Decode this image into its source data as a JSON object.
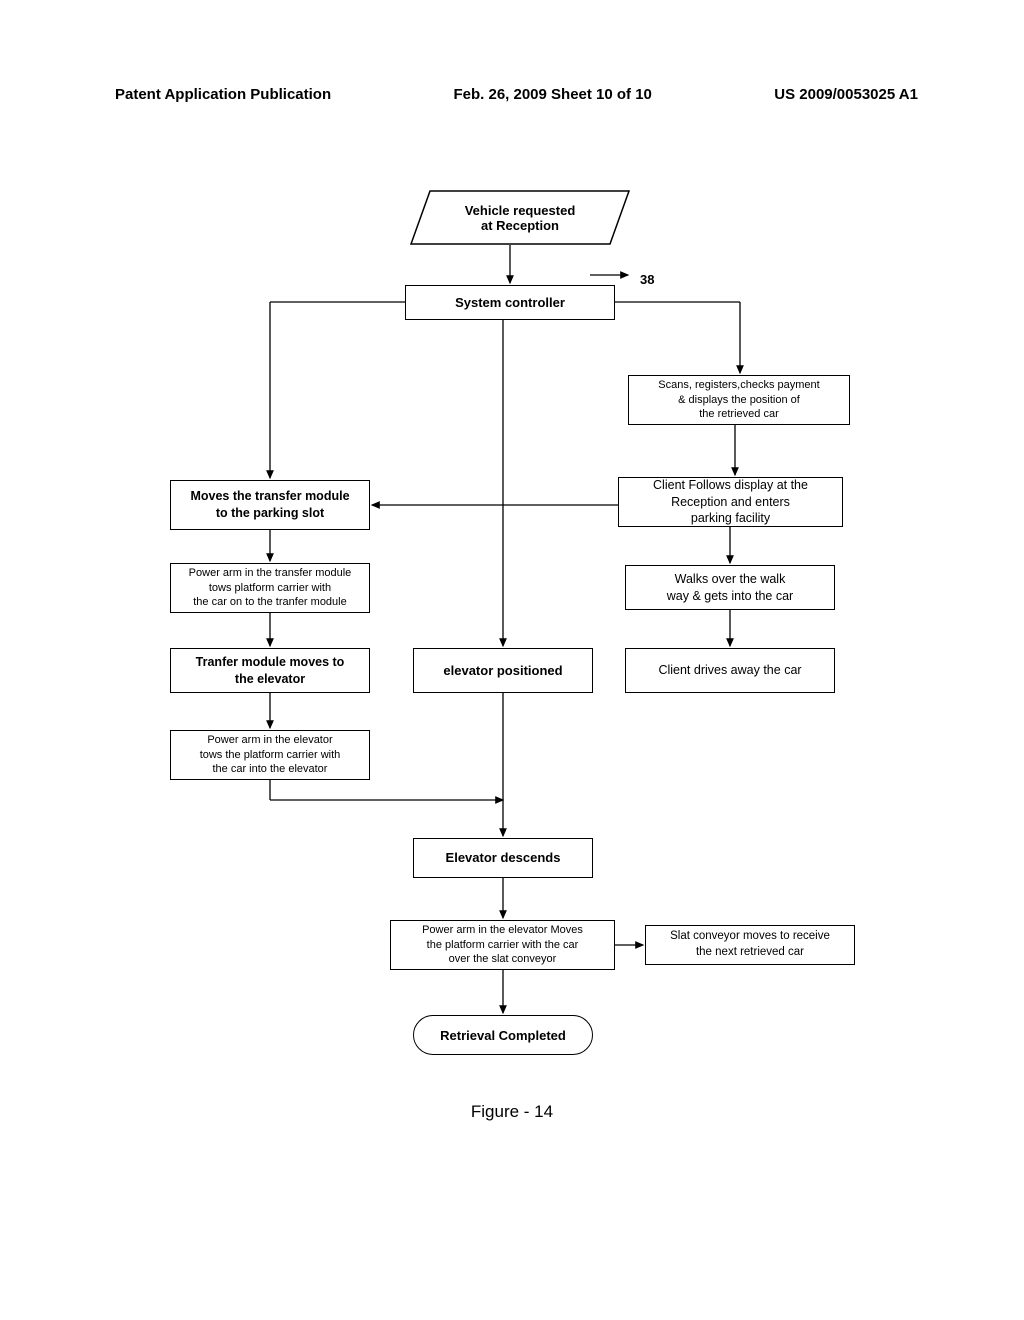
{
  "header": {
    "left": "Patent Application Publication",
    "middle": "Feb. 26, 2009  Sheet 10 of 10",
    "right": "US 2009/0053025 A1"
  },
  "nodes": {
    "start": "Vehicle requested\nat Reception",
    "controller": "System controller",
    "scan": "Scans, registers,checks payment\n& displays the position of\nthe retrieved car",
    "moveTransfer": "Moves the transfer module\nto the parking slot",
    "clientFollows": "Client Follows display at the\nReception and enters\nparking facility",
    "powerArmTransfer": "Power arm in the transfer module\ntows platform carrier with\nthe car on to the tranfer module",
    "walks": "Walks over the walk\nway & gets into the car",
    "transferElevator": "Tranfer module moves to\nthe elevator",
    "elevatorPos": "elevator positioned",
    "clientDrives": "Client drives away the car",
    "powerArmElevator": "Power arm in the elevator\ntows  the platform carrier with\nthe car into the elevator",
    "elevatorDesc": "Elevator descends",
    "powerArmSlat": "Power arm in the elevator Moves\nthe platform carrier with the car\nover the slat conveyor",
    "slatConveyor": "Slat conveyor moves to receive\nthe next retrieved car",
    "retrievalComplete": "Retrieval Completed"
  },
  "label38": "38",
  "caption": "Figure - 14"
}
